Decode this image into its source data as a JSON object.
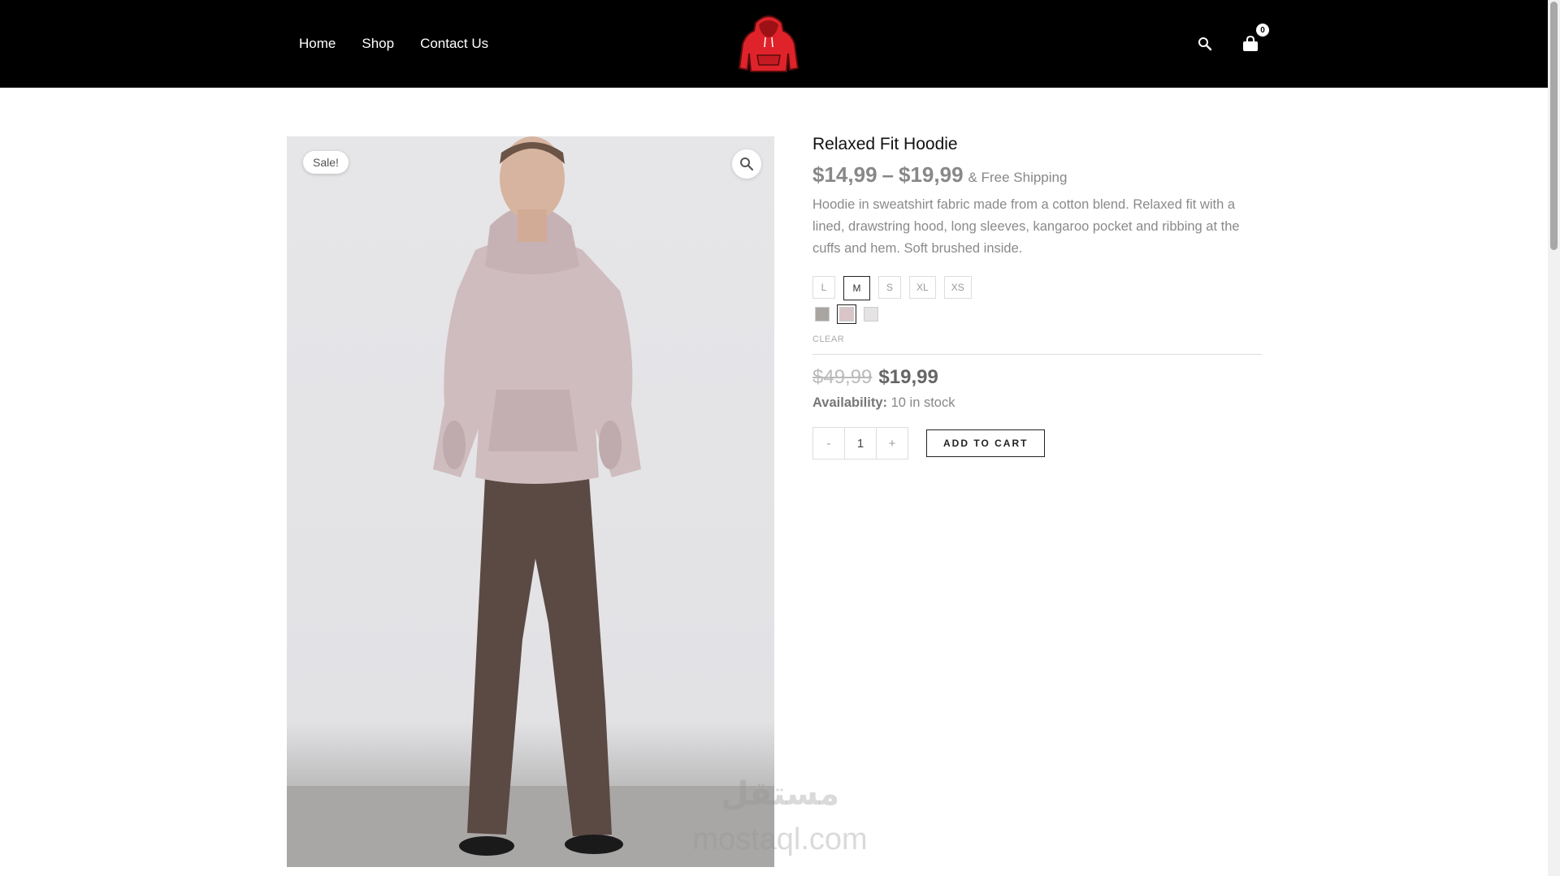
{
  "nav": {
    "items": [
      {
        "label": "Home"
      },
      {
        "label": "Shop"
      },
      {
        "label": "Contact Us"
      }
    ]
  },
  "header": {
    "cart_count": "0",
    "logo_icon": "red-hoodie-logo",
    "search_icon": "search-icon",
    "cart_icon": "shopping-bag-icon"
  },
  "product": {
    "sale_badge": "Sale!",
    "title": "Relaxed Fit Hoodie",
    "price_min": "$14,99",
    "price_sep": "–",
    "price_max": "$19,99",
    "shipping_note": "& Free Shipping",
    "description": "Hoodie in sweatshirt fabric made from a cotton blend. Relaxed fit with a lined, drawstring hood, long sleeves, kangaroo pocket and ribbing at the cuffs and hem. Soft brushed inside.",
    "sizes": [
      {
        "label": "L",
        "selected": false
      },
      {
        "label": "M",
        "selected": true
      },
      {
        "label": "S",
        "selected": false
      },
      {
        "label": "XL",
        "selected": false
      },
      {
        "label": "XS",
        "selected": false
      }
    ],
    "colors": [
      {
        "hex": "#a9a6a2",
        "selected": false
      },
      {
        "hex": "#d9c5c8",
        "selected": true
      },
      {
        "hex": "#e5e3e3",
        "selected": false
      }
    ],
    "clear_label": "CLEAR",
    "old_price": "$49,99",
    "new_price": "$19,99",
    "availability_label": "Availability:",
    "availability_value": "10 in stock",
    "qty_minus": "-",
    "qty_value": "1",
    "qty_plus": "+",
    "add_to_cart": "ADD TO CART"
  },
  "watermark": {
    "arabic": "مستقل",
    "latin": "mostaql.com"
  }
}
